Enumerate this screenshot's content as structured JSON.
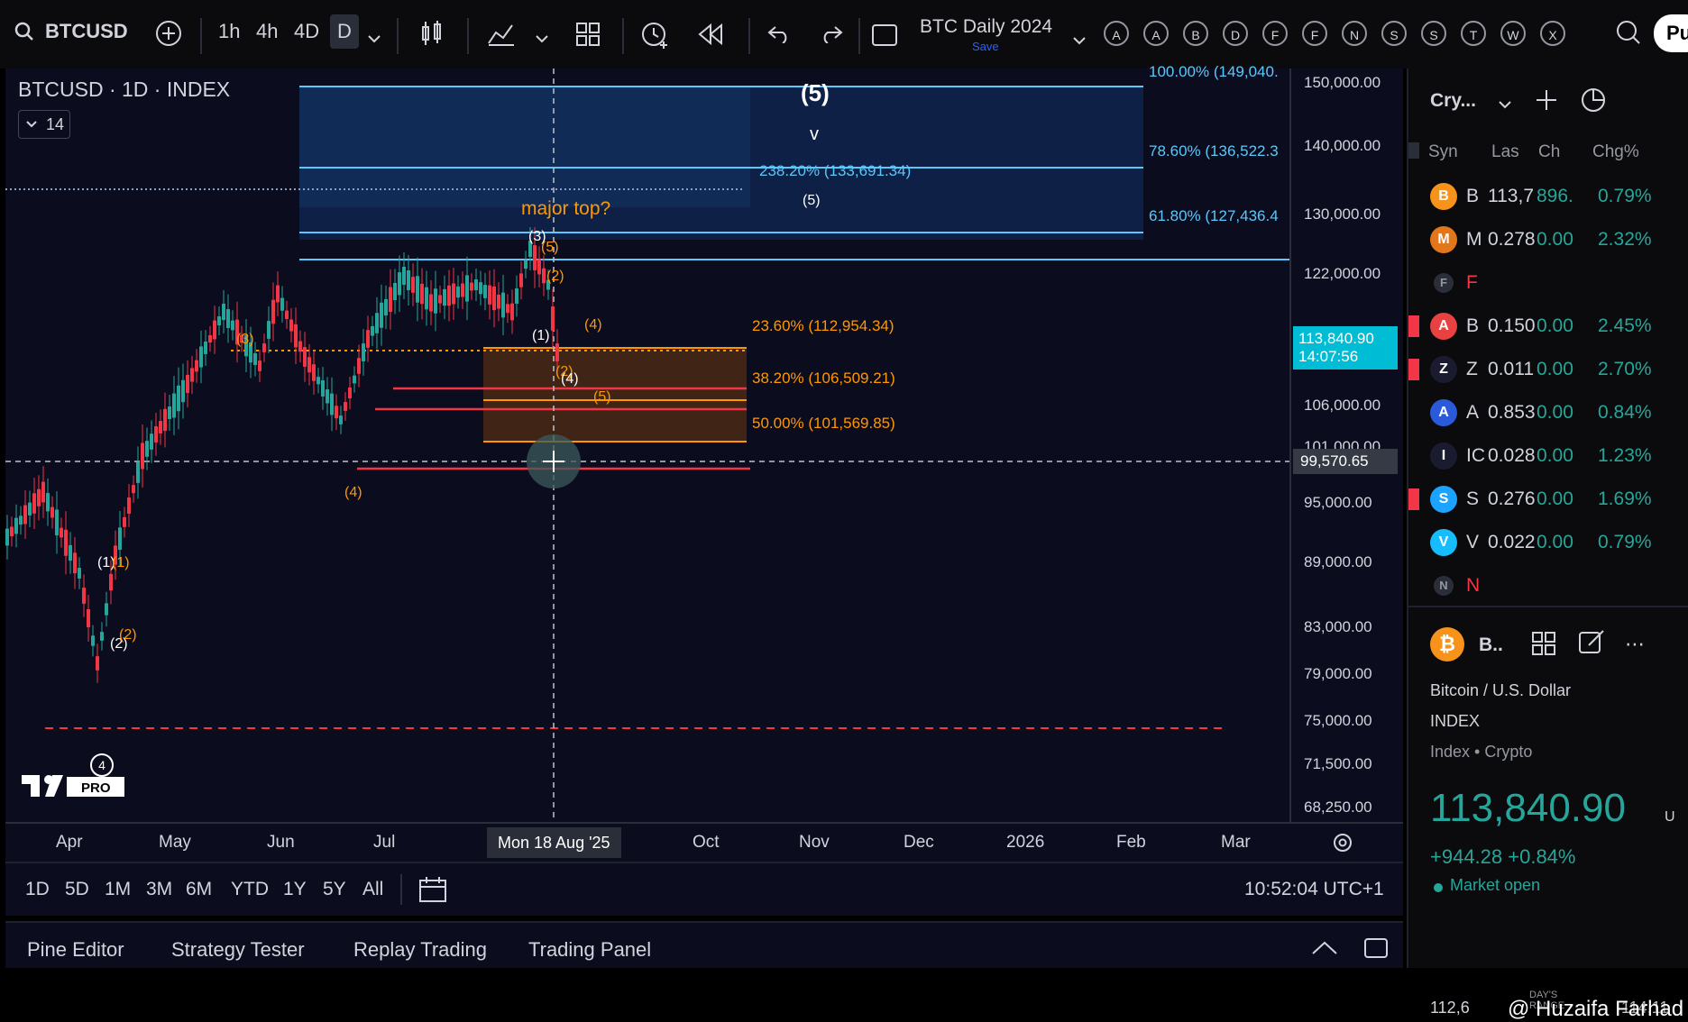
{
  "toolbar": {
    "symbol": "BTCUSD",
    "intervals": [
      "1h",
      "4h",
      "4D",
      "D"
    ],
    "layout_title": "BTC Daily 2024",
    "layout_save": "Save",
    "alerts_letters": [
      "A",
      "A",
      "B",
      "D",
      "F",
      "F",
      "N",
      "S",
      "S",
      "T",
      "W",
      "X"
    ],
    "publish_label": "Pu"
  },
  "chart": {
    "header": "BTCUSD · 1D · INDEX",
    "indicator_count": "14",
    "crosshair_date": "Mon 18 Aug '25",
    "annotations": {
      "wave5_top": "(5)",
      "wave_v": "v",
      "fib_238": "238.20% (133,691.34)",
      "wave5_small": "(5)",
      "major_top": "major top?",
      "wave3_top": "(3)",
      "wave5_orange": "(5)",
      "wave2_orange": "(2)",
      "wave4_orange": "(4)",
      "wave1_white": "(1)",
      "wave3_left": "(3)",
      "wave2_mid": "(2)",
      "wave4_mid": "(4)",
      "wave5_mid": "(5)",
      "wave4_low": "(4)",
      "wave1_left": "(1)",
      "wave1_left_orange": "(1)",
      "wave2_left": "(2)",
      "wave2_left_orange": "(2)",
      "wave4_circle": "4",
      "fib_100": "100.00% (149,040.",
      "fib_786": "78.60% (136,522.3",
      "fib_618": "61.80% (127,436.4",
      "fib_236": "23.60% (112,954.34)",
      "fib_382": "38.20% (106,509.21)",
      "fib_500": "50.00% (101,569.85)"
    },
    "logo_text": "PRO"
  },
  "price_scale": {
    "labels": [
      "150,000.00",
      "140,000.00",
      "130,000.00",
      "122,000.00",
      "106,000.00",
      "101,000.00",
      "95,000.00",
      "89,000.00",
      "83,000.00",
      "79,000.00",
      "75,000.00",
      "71,500.00",
      "68,250.00"
    ],
    "last_price": "113,840.90",
    "countdown": "14:07:56",
    "crosshair_price": "99,570.65"
  },
  "time_axis": {
    "labels": [
      "Apr",
      "May",
      "Jun",
      "Jul",
      "Oct",
      "Nov",
      "Dec",
      "2026",
      "Feb",
      "Mar"
    ]
  },
  "range_bar": {
    "ranges": [
      "1D",
      "5D",
      "1M",
      "3M",
      "6M",
      "YTD",
      "1Y",
      "5Y",
      "All"
    ],
    "clock": "10:52:04 UTC+1"
  },
  "bottom_panel": {
    "tabs": [
      "Pine Editor",
      "Strategy Tester",
      "Replay Trading",
      "Trading Panel"
    ]
  },
  "watchlist": {
    "title": "Cry...",
    "columns": [
      "Syn",
      "Las",
      "Ch",
      "Chg%"
    ],
    "rows": [
      {
        "icon": "B",
        "sym": "B",
        "last": "113,7",
        "chg": "896.",
        "chgp": "0.79%",
        "color": "#f7931a",
        "flag": false
      },
      {
        "icon": "M",
        "sym": "M",
        "last": "0.278",
        "chg": "0.00",
        "chgp": "2.32%",
        "color": "#e2761b",
        "flag": false
      },
      {
        "icon": "F",
        "sym": "F",
        "last": "",
        "chg": "",
        "chgp": "",
        "color": "#2a2e39",
        "flag": false,
        "section": true
      },
      {
        "icon": "A",
        "sym": "B",
        "last": "0.150",
        "chg": "0.00",
        "chgp": "2.45%",
        "color": "#e84142",
        "flag": true
      },
      {
        "icon": "Z",
        "sym": "Z",
        "last": "0.011",
        "chg": "0.00",
        "chgp": "2.70%",
        "color": "#1b1b2f",
        "flag": true
      },
      {
        "icon": "A",
        "sym": "A",
        "last": "0.853",
        "chg": "0.00",
        "chgp": "0.84%",
        "color": "#2a5ada",
        "flag": false
      },
      {
        "icon": "I",
        "sym": "IC",
        "last": "0.028",
        "chg": "0.00",
        "chgp": "1.23%",
        "color": "#1b1b2f",
        "flag": false
      },
      {
        "icon": "S",
        "sym": "S",
        "last": "0.276",
        "chg": "0.00",
        "chgp": "1.69%",
        "color": "#1ba3ff",
        "flag": true
      },
      {
        "icon": "V",
        "sym": "V",
        "last": "0.022",
        "chg": "0.00",
        "chgp": "0.79%",
        "color": "#15bdff",
        "flag": false
      },
      {
        "icon": "N",
        "sym": "N",
        "last": "",
        "chg": "",
        "chgp": "",
        "color": "#2a2e39",
        "flag": false,
        "section": true
      }
    ],
    "detail": {
      "short": "B..",
      "name": "Bitcoin / U.S. Dollar",
      "exchange": "INDEX",
      "type": "Index • Crypto",
      "price": "113,840.90",
      "currency": "U",
      "change": "+944.28 +0.84%",
      "status": "Market open",
      "days_range_label": "DAY'S RANGE",
      "days_low": "112,6",
      "days_high": "114,11",
      "watermark": "@ Huzaifa Farhad"
    }
  },
  "colors": {
    "accent_up": "#26a69a",
    "accent_down": "#f23645",
    "fib_blue": "#5ac8fa",
    "fib_orange": "#ff9800"
  }
}
